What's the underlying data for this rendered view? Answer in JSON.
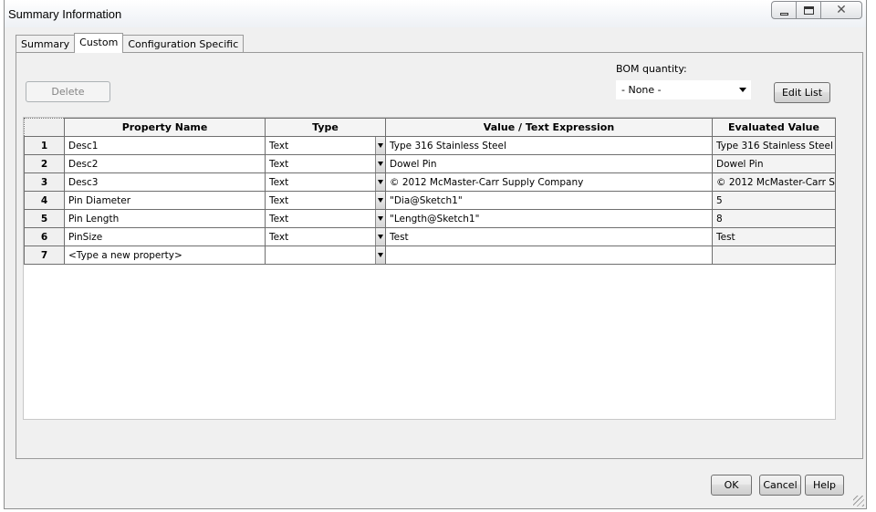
{
  "window": {
    "title": "Summary Information",
    "close_glyph": "✕"
  },
  "tabs": [
    {
      "label": "Summary"
    },
    {
      "label": "Custom"
    },
    {
      "label": "Configuration Specific"
    }
  ],
  "toolbar": {
    "delete_label": "Delete",
    "bom_quantity_label": "BOM quantity:",
    "bom_quantity_value": "- None -",
    "edit_list_label": "Edit List"
  },
  "grid": {
    "columns": [
      "Property Name",
      "Type",
      "Value / Text Expression",
      "Evaluated Value"
    ],
    "rows": [
      {
        "num": "1",
        "name": "Desc1",
        "type": "Text",
        "value": "Type 316 Stainless Steel",
        "evaluated": "Type 316 Stainless Steel"
      },
      {
        "num": "2",
        "name": "Desc2",
        "type": "Text",
        "value": "Dowel Pin",
        "evaluated": "Dowel Pin"
      },
      {
        "num": "3",
        "name": "Desc3",
        "type": "Text",
        "value": "© 2012 McMaster-Carr Supply Company",
        "evaluated": "© 2012 McMaster-Carr S"
      },
      {
        "num": "4",
        "name": "Pin Diameter",
        "type": "Text",
        "value": "\"Dia@Sketch1\"",
        "evaluated": "5"
      },
      {
        "num": "5",
        "name": "Pin Length",
        "type": "Text",
        "value": "\"Length@Sketch1\"",
        "evaluated": "8"
      },
      {
        "num": "6",
        "name": "PinSize",
        "type": "Text",
        "value": "Test",
        "evaluated": "Test"
      },
      {
        "num": "7",
        "name": "<Type a new property>",
        "type": "",
        "value": "",
        "evaluated": ""
      }
    ]
  },
  "footer": {
    "ok_label": "OK",
    "cancel_label": "Cancel",
    "help_label": "Help"
  },
  "icons": {
    "minimize": "minimize-icon",
    "maximize": "maximize-icon",
    "close": "close-icon",
    "dropdown": "chevron-down-icon"
  }
}
